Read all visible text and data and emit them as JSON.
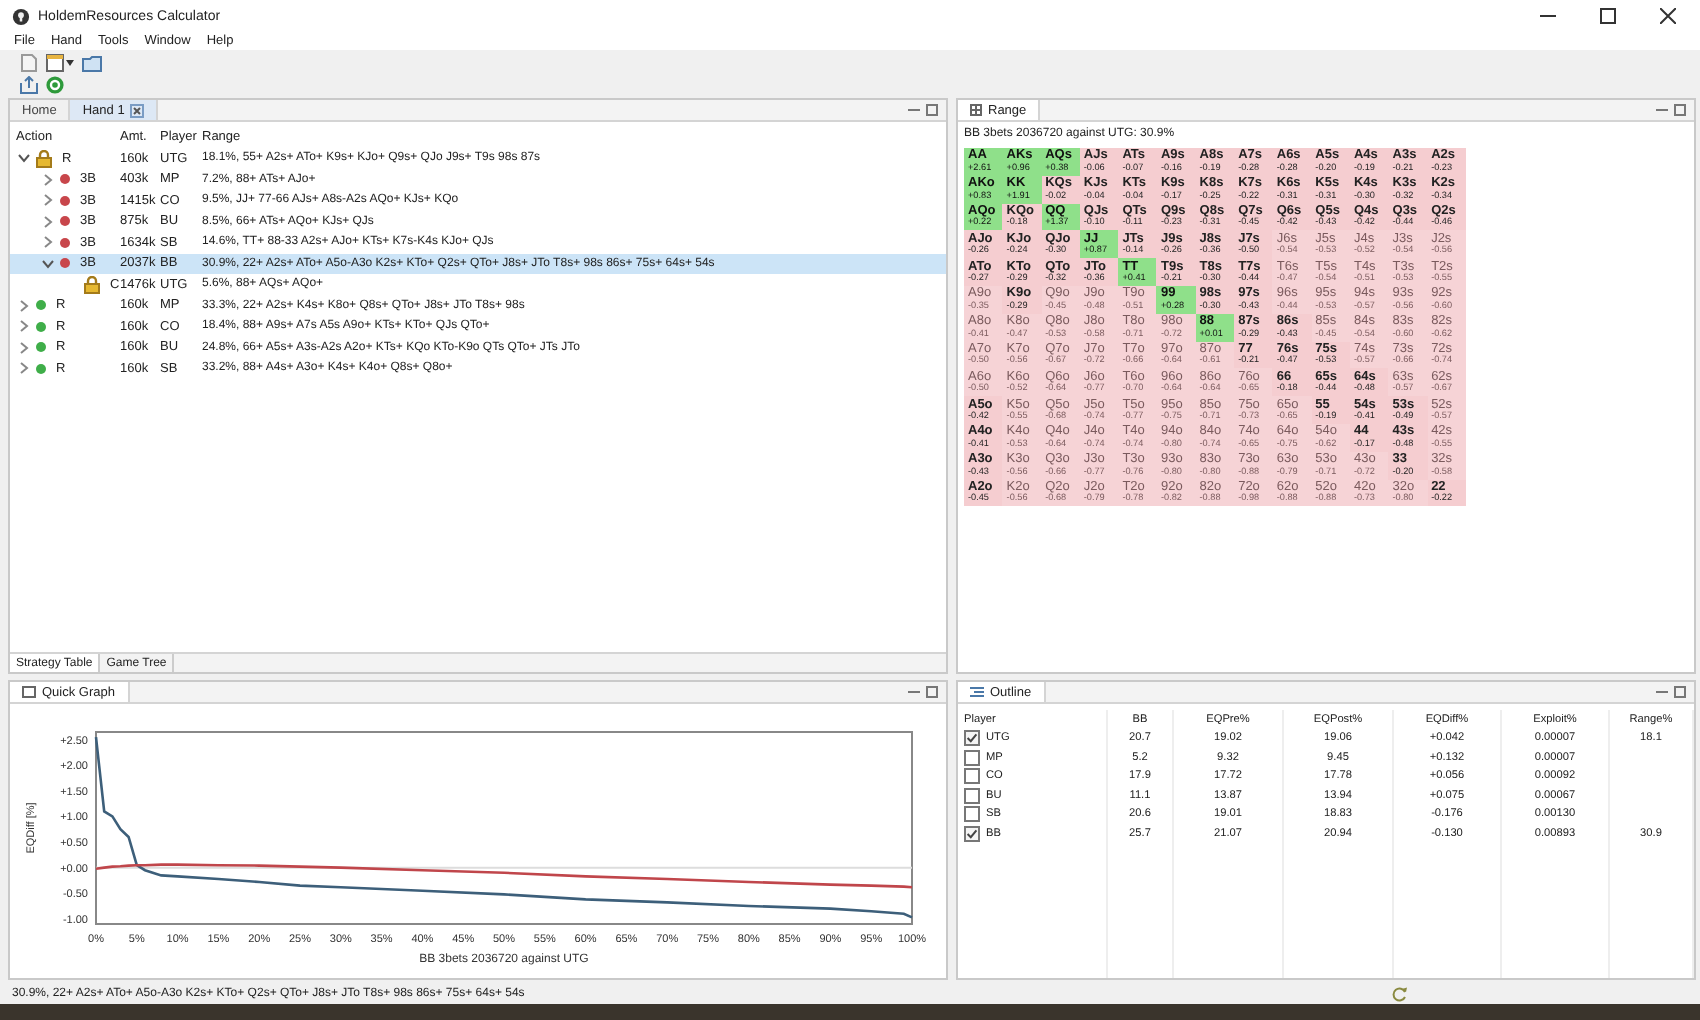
{
  "window": {
    "title": "HoldemResources Calculator"
  },
  "menu": [
    "File",
    "Hand",
    "Tools",
    "Window",
    "Help"
  ],
  "editor_tabs": [
    {
      "label": "Home",
      "selected": false
    },
    {
      "label": "Hand 1",
      "selected": true
    }
  ],
  "tree": {
    "columns": [
      "Action",
      "Amt.",
      "Player",
      "Range"
    ],
    "rows": [
      {
        "action": "R",
        "amount": "160k",
        "player": "UTG",
        "range": "18.1%, 55+ A2s+ ATo+ K9s+ KJo+ Q9s+ QJo J9s+ T9s 98s 87s",
        "kind": "lock",
        "expanded": true,
        "selected": false,
        "children": [
          {
            "action": "3B",
            "amount": "403k",
            "player": "MP",
            "range": "7.2%, 88+ ATs+ AJo+",
            "kind": "dot",
            "color": "#c8464b",
            "expanded": false,
            "selected": false
          },
          {
            "action": "3B",
            "amount": "1415k",
            "player": "CO",
            "range": "9.5%, JJ+ 77-66 AJs+ A8s-A2s AQo+ KJs+ KQo",
            "kind": "dot",
            "color": "#c8464b",
            "expanded": false,
            "selected": false
          },
          {
            "action": "3B",
            "amount": "875k",
            "player": "BU",
            "range": "8.5%, 66+ ATs+ AQo+ KJs+ QJs",
            "kind": "dot",
            "color": "#c8464b",
            "expanded": false,
            "selected": false
          },
          {
            "action": "3B",
            "amount": "1634k",
            "player": "SB",
            "range": "14.6%, TT+ 88-33 A2s+ AJo+ KTs+ K7s-K4s KJo+ QJs",
            "kind": "dot",
            "color": "#c8464b",
            "expanded": false,
            "selected": false
          },
          {
            "action": "3B",
            "amount": "2037k",
            "player": "BB",
            "range": "30.9%, 22+ A2s+ ATo+ A5o-A3o K2s+ KTo+ Q2s+ QTo+ J8s+ JTo T8s+ 98s 86s+ 75s+ 64s+ 54s",
            "kind": "dot",
            "color": "#c8464b",
            "expanded": true,
            "selected": true,
            "children": [
              {
                "action": "C",
                "amount": "1476k",
                "player": "UTG",
                "range": "5.6%, 88+ AQs+ AQo+",
                "kind": "lock",
                "selected": false
              }
            ]
          }
        ]
      },
      {
        "action": "R",
        "amount": "160k",
        "player": "MP",
        "range": "33.3%, 22+ A2s+ K4s+ K8o+ Q8s+ QTo+ J8s+ JTo T8s+ 98s",
        "kind": "dot",
        "color": "#3fae49",
        "expanded": false,
        "selected": false
      },
      {
        "action": "R",
        "amount": "160k",
        "player": "CO",
        "range": "18.4%, 88+ A9s+ A7s A5s A9o+ KTs+ KTo+ QJs QTo+",
        "kind": "dot",
        "color": "#3fae49",
        "expanded": false,
        "selected": false
      },
      {
        "action": "R",
        "amount": "160k",
        "player": "BU",
        "range": "24.8%, 66+ A5s+ A3s-A2s A2o+ KTs+ KQo KTo-K9o QTs QTo+ JTs JTo",
        "kind": "dot",
        "color": "#3fae49",
        "expanded": false,
        "selected": false
      },
      {
        "action": "R",
        "amount": "160k",
        "player": "SB",
        "range": "33.2%, 88+ A4s+ A3o+ K4s+ K4o+ Q8s+ Q8o+",
        "kind": "dot",
        "color": "#3fae49",
        "expanded": false,
        "selected": false
      }
    ]
  },
  "bottom_tabs": [
    {
      "label": "Strategy Table",
      "selected": true
    },
    {
      "label": "Game Tree",
      "selected": false
    }
  ],
  "range": {
    "tab": "Range",
    "header": "BB 3bets 2036720 against UTG: 30.9%",
    "rows": [
      {
        "cells": [
          {
            "hand": "AA",
            "ev": "+2.61",
            "in_range": true,
            "kind": "plus"
          },
          {
            "hand": "AKs",
            "ev": "+0.96",
            "in_range": true,
            "kind": "plus"
          },
          {
            "hand": "AQs",
            "ev": "+0.38",
            "in_range": true,
            "kind": "plus"
          },
          {
            "hand": "AJs",
            "ev": "-0.06",
            "in_range": true,
            "kind": "minus"
          },
          {
            "hand": "ATs",
            "ev": "-0.07",
            "in_range": true,
            "kind": "minus"
          },
          {
            "hand": "A9s",
            "ev": "-0.16",
            "in_range": true,
            "kind": "minus"
          },
          {
            "hand": "A8s",
            "ev": "-0.19",
            "in_range": true,
            "kind": "minus"
          },
          {
            "hand": "A7s",
            "ev": "-0.28",
            "in_range": true,
            "kind": "minus"
          },
          {
            "hand": "A6s",
            "ev": "-0.28",
            "in_range": true,
            "kind": "minus"
          },
          {
            "hand": "A5s",
            "ev": "-0.20",
            "in_range": true,
            "kind": "minus"
          },
          {
            "hand": "A4s",
            "ev": "-0.19",
            "in_range": true,
            "kind": "minus"
          },
          {
            "hand": "A3s",
            "ev": "-0.21",
            "in_range": true,
            "kind": "minus"
          },
          {
            "hand": "A2s",
            "ev": "-0.23",
            "in_range": true,
            "kind": "minus"
          }
        ]
      },
      {
        "cells": [
          {
            "hand": "AKo",
            "ev": "+0.83",
            "in_range": true,
            "kind": "plus"
          },
          {
            "hand": "KK",
            "ev": "+1.91",
            "in_range": true,
            "kind": "plus"
          },
          {
            "hand": "KQs",
            "ev": "-0.02",
            "in_range": true,
            "kind": "minus"
          },
          {
            "hand": "KJs",
            "ev": "-0.04",
            "in_range": true,
            "kind": "minus"
          },
          {
            "hand": "KTs",
            "ev": "-0.04",
            "in_range": true,
            "kind": "minus"
          },
          {
            "hand": "K9s",
            "ev": "-0.17",
            "in_range": true,
            "kind": "minus"
          },
          {
            "hand": "K8s",
            "ev": "-0.25",
            "in_range": true,
            "kind": "minus"
          },
          {
            "hand": "K7s",
            "ev": "-0.22",
            "in_range": true,
            "kind": "minus"
          },
          {
            "hand": "K6s",
            "ev": "-0.31",
            "in_range": true,
            "kind": "minus"
          },
          {
            "hand": "K5s",
            "ev": "-0.31",
            "in_range": true,
            "kind": "minus"
          },
          {
            "hand": "K4s",
            "ev": "-0.30",
            "in_range": true,
            "kind": "minus"
          },
          {
            "hand": "K3s",
            "ev": "-0.32",
            "in_range": true,
            "kind": "minus"
          },
          {
            "hand": "K2s",
            "ev": "-0.34",
            "in_range": true,
            "kind": "minus"
          }
        ]
      },
      {
        "cells": [
          {
            "hand": "AQo",
            "ev": "+0.22",
            "in_range": true,
            "kind": "plus"
          },
          {
            "hand": "KQo",
            "ev": "-0.18",
            "in_range": true,
            "kind": "minus"
          },
          {
            "hand": "QQ",
            "ev": "+1.37",
            "in_range": true,
            "kind": "plus"
          },
          {
            "hand": "QJs",
            "ev": "-0.10",
            "in_range": true,
            "kind": "minus"
          },
          {
            "hand": "QTs",
            "ev": "-0.11",
            "in_range": true,
            "kind": "minus"
          },
          {
            "hand": "Q9s",
            "ev": "-0.23",
            "in_range": true,
            "kind": "minus"
          },
          {
            "hand": "Q8s",
            "ev": "-0.31",
            "in_range": true,
            "kind": "minus"
          },
          {
            "hand": "Q7s",
            "ev": "-0.45",
            "in_range": true,
            "kind": "minus"
          },
          {
            "hand": "Q6s",
            "ev": "-0.42",
            "in_range": true,
            "kind": "minus"
          },
          {
            "hand": "Q5s",
            "ev": "-0.43",
            "in_range": true,
            "kind": "minus"
          },
          {
            "hand": "Q4s",
            "ev": "-0.42",
            "in_range": true,
            "kind": "minus"
          },
          {
            "hand": "Q3s",
            "ev": "-0.44",
            "in_range": true,
            "kind": "minus"
          },
          {
            "hand": "Q2s",
            "ev": "-0.46",
            "in_range": true,
            "kind": "minus"
          }
        ]
      },
      {
        "cells": [
          {
            "hand": "AJo",
            "ev": "-0.26",
            "in_range": true,
            "kind": "minus"
          },
          {
            "hand": "KJo",
            "ev": "-0.24",
            "in_range": true,
            "kind": "minus"
          },
          {
            "hand": "QJo",
            "ev": "-0.30",
            "in_range": true,
            "kind": "minus"
          },
          {
            "hand": "JJ",
            "ev": "+0.87",
            "in_range": true,
            "kind": "plus"
          },
          {
            "hand": "JTs",
            "ev": "-0.14",
            "in_range": true,
            "kind": "minus"
          },
          {
            "hand": "J9s",
            "ev": "-0.26",
            "in_range": true,
            "kind": "minus"
          },
          {
            "hand": "J8s",
            "ev": "-0.36",
            "in_range": true,
            "kind": "minus"
          },
          {
            "hand": "J7s",
            "ev": "-0.50",
            "in_range": true,
            "kind": "minus"
          },
          {
            "hand": "J6s",
            "ev": "-0.54",
            "in_range": false,
            "kind": "minus"
          },
          {
            "hand": "J5s",
            "ev": "-0.53",
            "in_range": false,
            "kind": "minus"
          },
          {
            "hand": "J4s",
            "ev": "-0.52",
            "in_range": false,
            "kind": "minus"
          },
          {
            "hand": "J3s",
            "ev": "-0.54",
            "in_range": false,
            "kind": "minus"
          },
          {
            "hand": "J2s",
            "ev": "-0.56",
            "in_range": false,
            "kind": "minus"
          }
        ]
      },
      {
        "cells": [
          {
            "hand": "ATo",
            "ev": "-0.27",
            "in_range": true,
            "kind": "minus"
          },
          {
            "hand": "KTo",
            "ev": "-0.29",
            "in_range": true,
            "kind": "minus"
          },
          {
            "hand": "QTo",
            "ev": "-0.32",
            "in_range": true,
            "kind": "minus"
          },
          {
            "hand": "JTo",
            "ev": "-0.36",
            "in_range": true,
            "kind": "minus"
          },
          {
            "hand": "TT",
            "ev": "+0.41",
            "in_range": true,
            "kind": "plus"
          },
          {
            "hand": "T9s",
            "ev": "-0.21",
            "in_range": true,
            "kind": "minus"
          },
          {
            "hand": "T8s",
            "ev": "-0.30",
            "in_range": true,
            "kind": "minus"
          },
          {
            "hand": "T7s",
            "ev": "-0.44",
            "in_range": true,
            "kind": "minus"
          },
          {
            "hand": "T6s",
            "ev": "-0.47",
            "in_range": false,
            "kind": "minus"
          },
          {
            "hand": "T5s",
            "ev": "-0.54",
            "in_range": false,
            "kind": "minus"
          },
          {
            "hand": "T4s",
            "ev": "-0.51",
            "in_range": false,
            "kind": "minus"
          },
          {
            "hand": "T3s",
            "ev": "-0.53",
            "in_range": false,
            "kind": "minus"
          },
          {
            "hand": "T2s",
            "ev": "-0.55",
            "in_range": false,
            "kind": "minus"
          }
        ]
      },
      {
        "cells": [
          {
            "hand": "A9o",
            "ev": "-0.35",
            "in_range": false,
            "kind": "minus"
          },
          {
            "hand": "K9o",
            "ev": "-0.29",
            "in_range": true,
            "kind": "minus"
          },
          {
            "hand": "Q9o",
            "ev": "-0.45",
            "in_range": false,
            "kind": "minus"
          },
          {
            "hand": "J9o",
            "ev": "-0.48",
            "in_range": false,
            "kind": "minus"
          },
          {
            "hand": "T9o",
            "ev": "-0.51",
            "in_range": false,
            "kind": "minus"
          },
          {
            "hand": "99",
            "ev": "+0.28",
            "in_range": true,
            "kind": "plus"
          },
          {
            "hand": "98s",
            "ev": "-0.30",
            "in_range": true,
            "kind": "minus"
          },
          {
            "hand": "97s",
            "ev": "-0.43",
            "in_range": true,
            "kind": "minus"
          },
          {
            "hand": "96s",
            "ev": "-0.44",
            "in_range": false,
            "kind": "minus"
          },
          {
            "hand": "95s",
            "ev": "-0.53",
            "in_range": false,
            "kind": "minus"
          },
          {
            "hand": "94s",
            "ev": "-0.57",
            "in_range": false,
            "kind": "minus"
          },
          {
            "hand": "93s",
            "ev": "-0.56",
            "in_range": false,
            "kind": "minus"
          },
          {
            "hand": "92s",
            "ev": "-0.60",
            "in_range": false,
            "kind": "minus"
          }
        ]
      },
      {
        "cells": [
          {
            "hand": "A8o",
            "ev": "-0.41",
            "in_range": false,
            "kind": "minus"
          },
          {
            "hand": "K8o",
            "ev": "-0.47",
            "in_range": false,
            "kind": "minus"
          },
          {
            "hand": "Q8o",
            "ev": "-0.53",
            "in_range": false,
            "kind": "minus"
          },
          {
            "hand": "J8o",
            "ev": "-0.58",
            "in_range": false,
            "kind": "minus"
          },
          {
            "hand": "T8o",
            "ev": "-0.71",
            "in_range": false,
            "kind": "minus"
          },
          {
            "hand": "98o",
            "ev": "-0.72",
            "in_range": false,
            "kind": "minus"
          },
          {
            "hand": "88",
            "ev": "+0.01",
            "in_range": true,
            "kind": "plus"
          },
          {
            "hand": "87s",
            "ev": "-0.29",
            "in_range": true,
            "kind": "minus"
          },
          {
            "hand": "86s",
            "ev": "-0.43",
            "in_range": true,
            "kind": "minus"
          },
          {
            "hand": "85s",
            "ev": "-0.45",
            "in_range": false,
            "kind": "minus"
          },
          {
            "hand": "84s",
            "ev": "-0.54",
            "in_range": false,
            "kind": "minus"
          },
          {
            "hand": "83s",
            "ev": "-0.60",
            "in_range": false,
            "kind": "minus"
          },
          {
            "hand": "82s",
            "ev": "-0.62",
            "in_range": false,
            "kind": "minus"
          }
        ]
      },
      {
        "cells": [
          {
            "hand": "A7o",
            "ev": "-0.50",
            "in_range": false,
            "kind": "minus"
          },
          {
            "hand": "K7o",
            "ev": "-0.56",
            "in_range": false,
            "kind": "minus"
          },
          {
            "hand": "Q7o",
            "ev": "-0.67",
            "in_range": false,
            "kind": "minus"
          },
          {
            "hand": "J7o",
            "ev": "-0.72",
            "in_range": false,
            "kind": "minus"
          },
          {
            "hand": "T7o",
            "ev": "-0.66",
            "in_range": false,
            "kind": "minus"
          },
          {
            "hand": "97o",
            "ev": "-0.64",
            "in_range": false,
            "kind": "minus"
          },
          {
            "hand": "87o",
            "ev": "-0.61",
            "in_range": false,
            "kind": "minus"
          },
          {
            "hand": "77",
            "ev": "-0.21",
            "in_range": true,
            "kind": "minus"
          },
          {
            "hand": "76s",
            "ev": "-0.47",
            "in_range": true,
            "kind": "minus"
          },
          {
            "hand": "75s",
            "ev": "-0.53",
            "in_range": true,
            "kind": "minus"
          },
          {
            "hand": "74s",
            "ev": "-0.57",
            "in_range": false,
            "kind": "minus"
          },
          {
            "hand": "73s",
            "ev": "-0.66",
            "in_range": false,
            "kind": "minus"
          },
          {
            "hand": "72s",
            "ev": "-0.74",
            "in_range": false,
            "kind": "minus"
          }
        ]
      },
      {
        "cells": [
          {
            "hand": "A6o",
            "ev": "-0.50",
            "in_range": false,
            "kind": "minus"
          },
          {
            "hand": "K6o",
            "ev": "-0.52",
            "in_range": false,
            "kind": "minus"
          },
          {
            "hand": "Q6o",
            "ev": "-0.64",
            "in_range": false,
            "kind": "minus"
          },
          {
            "hand": "J6o",
            "ev": "-0.77",
            "in_range": false,
            "kind": "minus"
          },
          {
            "hand": "T6o",
            "ev": "-0.70",
            "in_range": false,
            "kind": "minus"
          },
          {
            "hand": "96o",
            "ev": "-0.64",
            "in_range": false,
            "kind": "minus"
          },
          {
            "hand": "86o",
            "ev": "-0.64",
            "in_range": false,
            "kind": "minus"
          },
          {
            "hand": "76o",
            "ev": "-0.65",
            "in_range": false,
            "kind": "minus"
          },
          {
            "hand": "66",
            "ev": "-0.18",
            "in_range": true,
            "kind": "minus"
          },
          {
            "hand": "65s",
            "ev": "-0.44",
            "in_range": true,
            "kind": "minus"
          },
          {
            "hand": "64s",
            "ev": "-0.48",
            "in_range": true,
            "kind": "minus"
          },
          {
            "hand": "63s",
            "ev": "-0.57",
            "in_range": false,
            "kind": "minus"
          },
          {
            "hand": "62s",
            "ev": "-0.67",
            "in_range": false,
            "kind": "minus"
          }
        ]
      },
      {
        "cells": [
          {
            "hand": "A5o",
            "ev": "-0.42",
            "in_range": true,
            "kind": "minus"
          },
          {
            "hand": "K5o",
            "ev": "-0.55",
            "in_range": false,
            "kind": "minus"
          },
          {
            "hand": "Q5o",
            "ev": "-0.68",
            "in_range": false,
            "kind": "minus"
          },
          {
            "hand": "J5o",
            "ev": "-0.74",
            "in_range": false,
            "kind": "minus"
          },
          {
            "hand": "T5o",
            "ev": "-0.77",
            "in_range": false,
            "kind": "minus"
          },
          {
            "hand": "95o",
            "ev": "-0.75",
            "in_range": false,
            "kind": "minus"
          },
          {
            "hand": "85o",
            "ev": "-0.71",
            "in_range": false,
            "kind": "minus"
          },
          {
            "hand": "75o",
            "ev": "-0.73",
            "in_range": false,
            "kind": "minus"
          },
          {
            "hand": "65o",
            "ev": "-0.65",
            "in_range": false,
            "kind": "minus"
          },
          {
            "hand": "55",
            "ev": "-0.19",
            "in_range": true,
            "kind": "minus"
          },
          {
            "hand": "54s",
            "ev": "-0.41",
            "in_range": true,
            "kind": "minus"
          },
          {
            "hand": "53s",
            "ev": "-0.49",
            "in_range": true,
            "kind": "minus"
          },
          {
            "hand": "52s",
            "ev": "-0.57",
            "in_range": false,
            "kind": "minus"
          }
        ]
      },
      {
        "cells": [
          {
            "hand": "A4o",
            "ev": "-0.41",
            "in_range": true,
            "kind": "minus"
          },
          {
            "hand": "K4o",
            "ev": "-0.53",
            "in_range": false,
            "kind": "minus"
          },
          {
            "hand": "Q4o",
            "ev": "-0.64",
            "in_range": false,
            "kind": "minus"
          },
          {
            "hand": "J4o",
            "ev": "-0.74",
            "in_range": false,
            "kind": "minus"
          },
          {
            "hand": "T4o",
            "ev": "-0.74",
            "in_range": false,
            "kind": "minus"
          },
          {
            "hand": "94o",
            "ev": "-0.80",
            "in_range": false,
            "kind": "minus"
          },
          {
            "hand": "84o",
            "ev": "-0.74",
            "in_range": false,
            "kind": "minus"
          },
          {
            "hand": "74o",
            "ev": "-0.65",
            "in_range": false,
            "kind": "minus"
          },
          {
            "hand": "64o",
            "ev": "-0.75",
            "in_range": false,
            "kind": "minus"
          },
          {
            "hand": "54o",
            "ev": "-0.62",
            "in_range": false,
            "kind": "minus"
          },
          {
            "hand": "44",
            "ev": "-0.17",
            "in_range": true,
            "kind": "minus"
          },
          {
            "hand": "43s",
            "ev": "-0.48",
            "in_range": true,
            "kind": "minus"
          },
          {
            "hand": "42s",
            "ev": "-0.55",
            "in_range": false,
            "kind": "minus"
          }
        ]
      },
      {
        "cells": [
          {
            "hand": "A3o",
            "ev": "-0.43",
            "in_range": true,
            "kind": "minus"
          },
          {
            "hand": "K3o",
            "ev": "-0.56",
            "in_range": false,
            "kind": "minus"
          },
          {
            "hand": "Q3o",
            "ev": "-0.66",
            "in_range": false,
            "kind": "minus"
          },
          {
            "hand": "J3o",
            "ev": "-0.77",
            "in_range": false,
            "kind": "minus"
          },
          {
            "hand": "T3o",
            "ev": "-0.76",
            "in_range": false,
            "kind": "minus"
          },
          {
            "hand": "93o",
            "ev": "-0.80",
            "in_range": false,
            "kind": "minus"
          },
          {
            "hand": "83o",
            "ev": "-0.80",
            "in_range": false,
            "kind": "minus"
          },
          {
            "hand": "73o",
            "ev": "-0.88",
            "in_range": false,
            "kind": "minus"
          },
          {
            "hand": "63o",
            "ev": "-0.79",
            "in_range": false,
            "kind": "minus"
          },
          {
            "hand": "53o",
            "ev": "-0.71",
            "in_range": false,
            "kind": "minus"
          },
          {
            "hand": "43o",
            "ev": "-0.72",
            "in_range": false,
            "kind": "minus"
          },
          {
            "hand": "33",
            "ev": "-0.20",
            "in_range": true,
            "kind": "minus"
          },
          {
            "hand": "32s",
            "ev": "-0.58",
            "in_range": false,
            "kind": "minus"
          }
        ]
      },
      {
        "cells": [
          {
            "hand": "A2o",
            "ev": "-0.45",
            "in_range": true,
            "kind": "minus"
          },
          {
            "hand": "K2o",
            "ev": "-0.56",
            "in_range": false,
            "kind": "minus"
          },
          {
            "hand": "Q2o",
            "ev": "-0.68",
            "in_range": false,
            "kind": "minus"
          },
          {
            "hand": "J2o",
            "ev": "-0.79",
            "in_range": false,
            "kind": "minus"
          },
          {
            "hand": "T2o",
            "ev": "-0.78",
            "in_range": false,
            "kind": "minus"
          },
          {
            "hand": "92o",
            "ev": "-0.82",
            "in_range": false,
            "kind": "minus"
          },
          {
            "hand": "82o",
            "ev": "-0.88",
            "in_range": false,
            "kind": "minus"
          },
          {
            "hand": "72o",
            "ev": "-0.98",
            "in_range": false,
            "kind": "minus"
          },
          {
            "hand": "62o",
            "ev": "-0.88",
            "in_range": false,
            "kind": "minus"
          },
          {
            "hand": "52o",
            "ev": "-0.88",
            "in_range": false,
            "kind": "minus"
          },
          {
            "hand": "42o",
            "ev": "-0.73",
            "in_range": false,
            "kind": "minus"
          },
          {
            "hand": "32o",
            "ev": "-0.80",
            "in_range": false,
            "kind": "minus"
          },
          {
            "hand": "22",
            "ev": "-0.22",
            "in_range": true,
            "kind": "minus"
          }
        ]
      }
    ]
  },
  "quick_graph": {
    "tab": "Quick Graph",
    "chart_data": {
      "type": "line",
      "xlabel": "BB 3bets 2036720 against UTG",
      "ylabel": "EQDiff [%]",
      "x": [
        0,
        1,
        2,
        3,
        4,
        5,
        6,
        8,
        10,
        15,
        20,
        25,
        30,
        40,
        50,
        60,
        70,
        80,
        90,
        95,
        99,
        100
      ],
      "series": [
        {
          "color": "#3d5f7a",
          "values": [
            2.55,
            1.1,
            1.0,
            0.75,
            0.6,
            0.05,
            -0.05,
            -0.15,
            -0.17,
            -0.22,
            -0.28,
            -0.35,
            -0.38,
            -0.45,
            -0.52,
            -0.62,
            -0.68,
            -0.75,
            -0.8,
            -0.85,
            -0.9,
            -0.97
          ]
        },
        {
          "color": "#c0464b",
          "values": [
            -0.02,
            0.0,
            0.02,
            0.03,
            0.04,
            0.05,
            0.05,
            0.06,
            0.06,
            0.05,
            0.04,
            0.02,
            0.0,
            -0.05,
            -0.1,
            -0.17,
            -0.22,
            -0.28,
            -0.33,
            -0.35,
            -0.37,
            -0.38
          ]
        }
      ],
      "xlim": [
        0,
        100
      ],
      "ylim": [
        -1.1,
        2.65
      ],
      "xticks": [
        {
          "value": 0,
          "label": "0%"
        },
        {
          "value": 5,
          "label": "5%"
        },
        {
          "value": 10,
          "label": "10%"
        },
        {
          "value": 15,
          "label": "15%"
        },
        {
          "value": 20,
          "label": "20%"
        },
        {
          "value": 25,
          "label": "25%"
        },
        {
          "value": 30,
          "label": "30%"
        },
        {
          "value": 35,
          "label": "35%"
        },
        {
          "value": 40,
          "label": "40%"
        },
        {
          "value": 45,
          "label": "45%"
        },
        {
          "value": 50,
          "label": "50%"
        },
        {
          "value": 55,
          "label": "55%"
        },
        {
          "value": 60,
          "label": "60%"
        },
        {
          "value": 65,
          "label": "65%"
        },
        {
          "value": 70,
          "label": "70%"
        },
        {
          "value": 75,
          "label": "75%"
        },
        {
          "value": 80,
          "label": "80%"
        },
        {
          "value": 85,
          "label": "85%"
        },
        {
          "value": 90,
          "label": "90%"
        },
        {
          "value": 95,
          "label": "95%"
        },
        {
          "value": 100,
          "label": "100%"
        }
      ],
      "yticks": [
        {
          "value": 2.5,
          "label": "+2.50"
        },
        {
          "value": 2,
          "label": "+2.00"
        },
        {
          "value": 1.5,
          "label": "+1.50"
        },
        {
          "value": 1,
          "label": "+1.00"
        },
        {
          "value": 0.5,
          "label": "+0.50"
        },
        {
          "value": 0,
          "label": "+0.00"
        },
        {
          "value": -0.5,
          "label": "-0.50"
        },
        {
          "value": -1,
          "label": "-1.00"
        }
      ]
    }
  },
  "outline": {
    "tab": "Outline",
    "columns": [
      "Player",
      "BB",
      "EQPre%",
      "EQPost%",
      "EQDiff%",
      "Exploit%",
      "Range%"
    ],
    "rows": [
      {
        "player": "UTG",
        "checked": true,
        "bb": "20.7",
        "eq_pre": "19.02",
        "eq_post": "19.06",
        "eq_diff": "+0.042",
        "exploit": "0.00007",
        "range": "18.1"
      },
      {
        "player": "MP",
        "checked": false,
        "bb": "5.2",
        "eq_pre": "9.32",
        "eq_post": "9.45",
        "eq_diff": "+0.132",
        "exploit": "0.00007"
      },
      {
        "player": "CO",
        "checked": false,
        "bb": "17.9",
        "eq_pre": "17.72",
        "eq_post": "17.78",
        "eq_diff": "+0.056",
        "exploit": "0.00092"
      },
      {
        "player": "BU",
        "checked": false,
        "bb": "11.1",
        "eq_pre": "13.87",
        "eq_post": "13.94",
        "eq_diff": "+0.075",
        "exploit": "0.00067"
      },
      {
        "player": "SB",
        "checked": false,
        "bb": "20.6",
        "eq_pre": "19.01",
        "eq_post": "18.83",
        "eq_diff": "-0.176",
        "exploit": "0.00130"
      },
      {
        "player": "BB",
        "checked": true,
        "bb": "25.7",
        "eq_pre": "21.07",
        "eq_post": "20.94",
        "eq_diff": "-0.130",
        "exploit": "0.00893",
        "range": "30.9"
      }
    ]
  },
  "status_bar": "30.9%, 22+ A2s+ ATo+ A5o-A3o K2s+ KTo+ Q2s+ QTo+ J8s+ JTo T8s+ 98s 86s+ 75s+ 64s+ 54s"
}
